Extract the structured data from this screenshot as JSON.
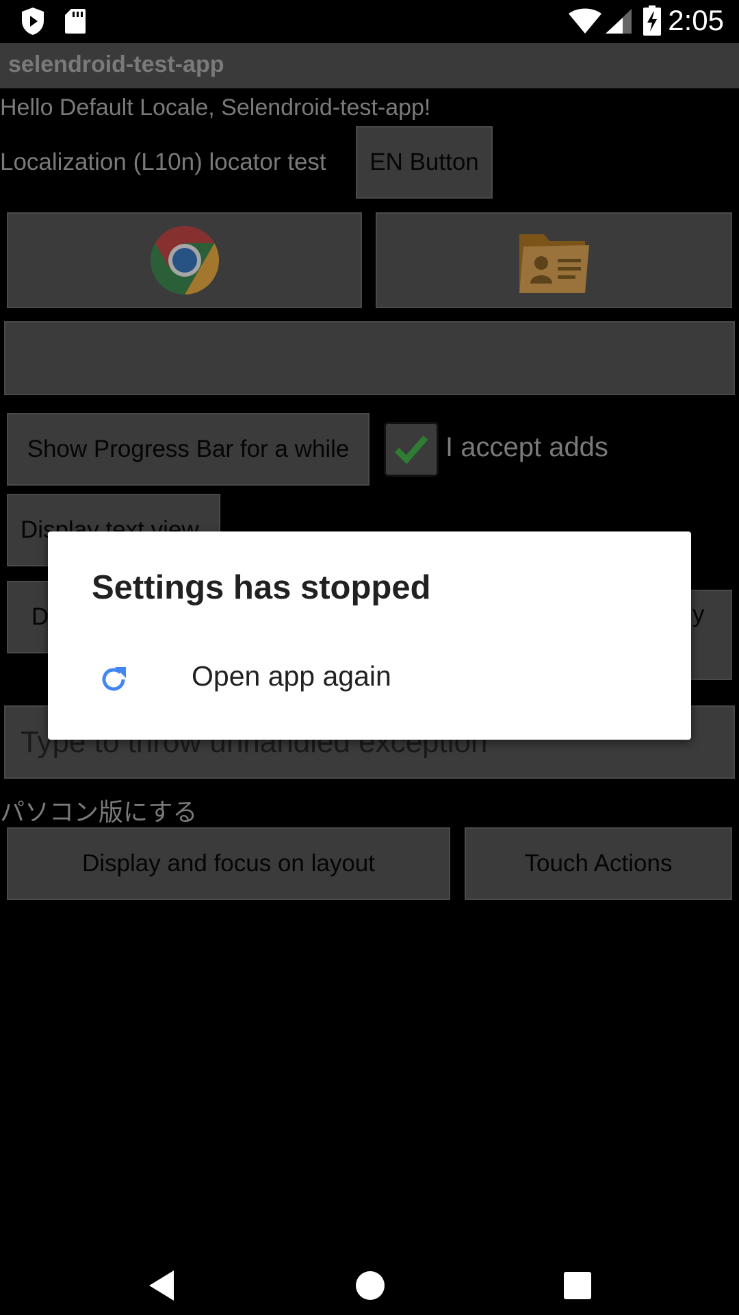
{
  "status_bar": {
    "time": "2:05",
    "icons": [
      "shield-notification-icon",
      "sd-card-icon",
      "wifi-icon",
      "cell-signal-icon",
      "battery-charging-icon"
    ]
  },
  "app": {
    "title": "selendroid-test-app",
    "hello_text": "Hello Default Locale, Selendroid-test-app!",
    "l10n_label": "Localization (L10n) locator test",
    "en_button": "EN Button",
    "show_progress_button": "Show Progress Bar for a while",
    "checkbox_label": "I accept adds",
    "checkbox_checked": true,
    "display_text_view_button": "Display text view",
    "partial_button_left": "D",
    "partial_button_right": "y",
    "exception_input_placeholder": "Type to throw unhandled exception",
    "japanese_link": "パソコン版にする",
    "display_focus_button": "Display and focus on layout",
    "touch_actions_button": "Touch Actions"
  },
  "dialog": {
    "title": "Settings has stopped",
    "action_label": "Open app again",
    "action_icon": "refresh-icon",
    "accent_color": "#4285f4"
  },
  "nav_bar": {
    "icons": [
      "back-icon",
      "home-icon",
      "recents-icon"
    ]
  }
}
